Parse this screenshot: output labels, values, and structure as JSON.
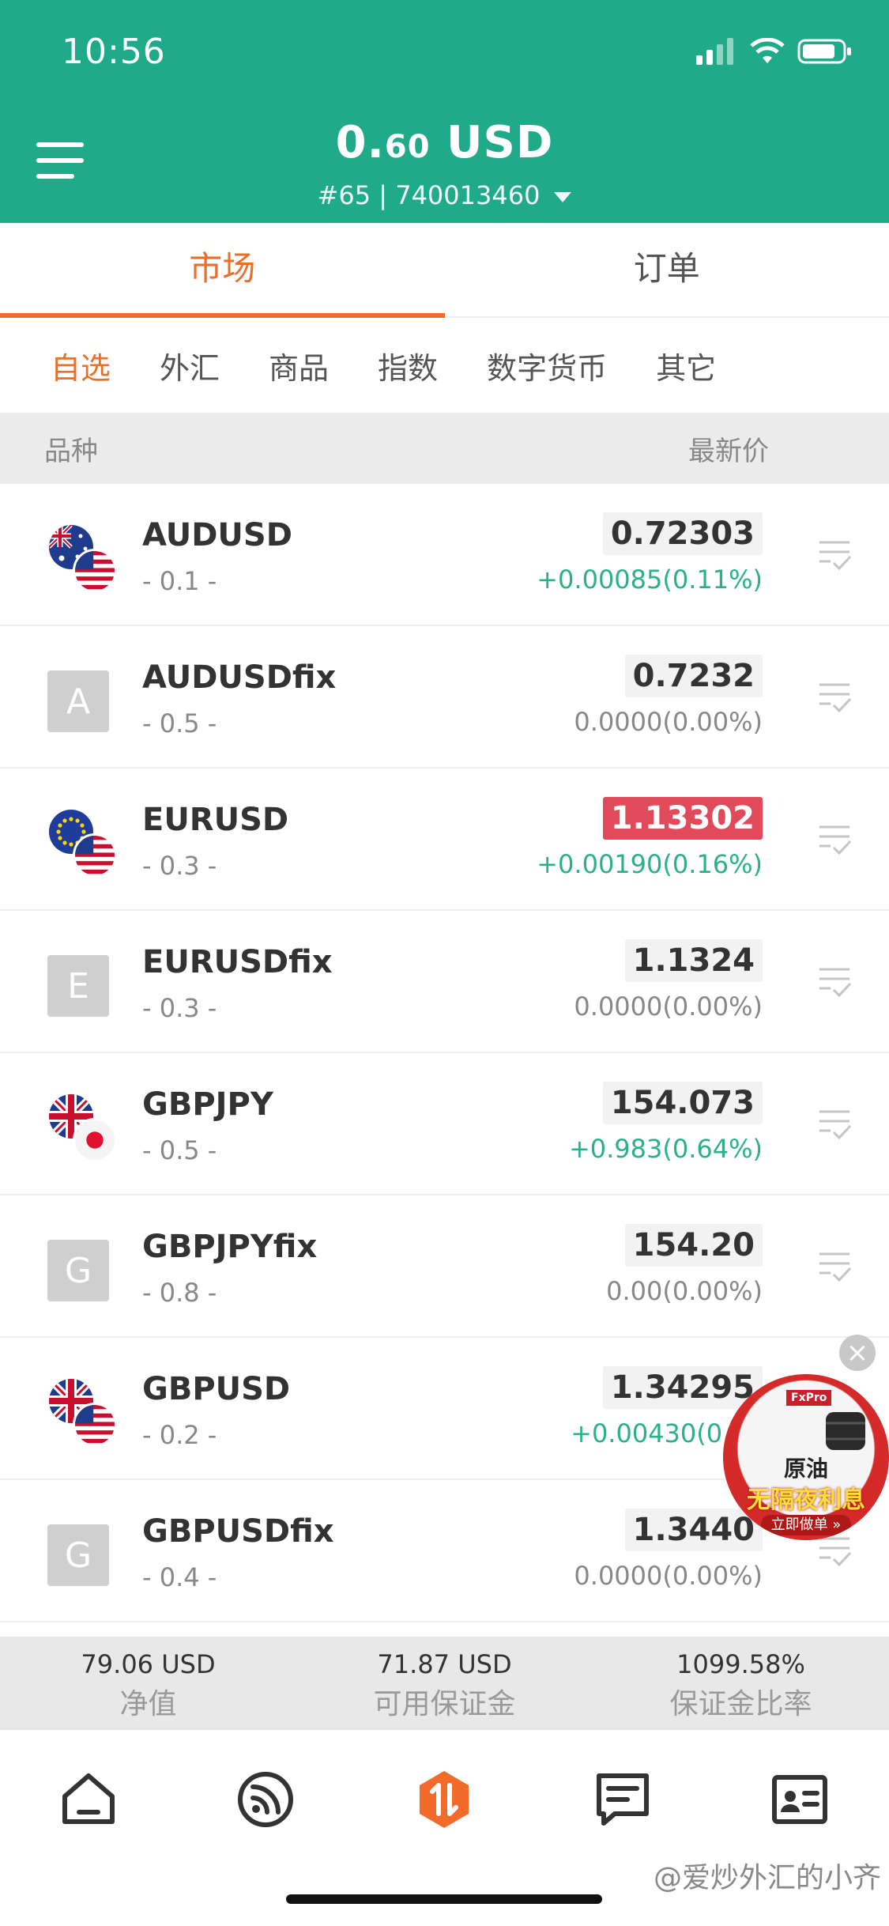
{
  "status": {
    "time": "10:56"
  },
  "header": {
    "balance_int": "0.",
    "balance_dec": "60",
    "balance_currency": " USD",
    "account": "#65 | 740013460"
  },
  "main_tabs": [
    {
      "label": "市场",
      "active": true
    },
    {
      "label": "订单",
      "active": false
    }
  ],
  "sub_tabs": [
    {
      "label": "自选",
      "active": true
    },
    {
      "label": "外汇",
      "active": false
    },
    {
      "label": "商品",
      "active": false
    },
    {
      "label": "指数",
      "active": false
    },
    {
      "label": "数字货币",
      "active": false
    },
    {
      "label": "其它",
      "active": false
    }
  ],
  "columns": {
    "symbol": "品种",
    "price": "最新价"
  },
  "rows": [
    {
      "symbol": "AUDUSD",
      "spread": "- 0.1 -",
      "price": "0.72303",
      "change": "+0.00085(0.11%)",
      "change_up": true,
      "price_down": false,
      "icon": "flag-au-us"
    },
    {
      "symbol": "AUDUSDfix",
      "spread": "- 0.5 -",
      "price": "0.7232",
      "change": "0.0000(0.00%)",
      "change_up": false,
      "price_down": false,
      "icon": "letter-icon",
      "letter": "A"
    },
    {
      "symbol": "EURUSD",
      "spread": "- 0.3 -",
      "price": "1.13302",
      "change": "+0.00190(0.16%)",
      "change_up": true,
      "price_down": true,
      "icon": "flag-eu-us"
    },
    {
      "symbol": "EURUSDfix",
      "spread": "- 0.3 -",
      "price": "1.1324",
      "change": "0.0000(0.00%)",
      "change_up": false,
      "price_down": false,
      "icon": "letter-icon",
      "letter": "E"
    },
    {
      "symbol": "GBPJPY",
      "spread": "- 0.5 -",
      "price": "154.073",
      "change": "+0.983(0.64%)",
      "change_up": true,
      "price_down": false,
      "icon": "flag-gb-jp"
    },
    {
      "symbol": "GBPJPYfix",
      "spread": "- 0.8 -",
      "price": "154.20",
      "change": "0.00(0.00%)",
      "change_up": false,
      "price_down": false,
      "icon": "letter-icon",
      "letter": "G"
    },
    {
      "symbol": "GBPUSD",
      "spread": "- 0.2 -",
      "price": "1.34295",
      "change": "+0.00430(0.32",
      "change_up": true,
      "price_down": false,
      "icon": "flag-gb-us"
    },
    {
      "symbol": "GBPUSDfix",
      "spread": "- 0.4 -",
      "price": "1.3440",
      "change": "0.0000(0.00%)",
      "change_up": false,
      "price_down": false,
      "icon": "letter-icon",
      "letter": "G"
    }
  ],
  "summary": [
    {
      "value": "79.06 USD",
      "label": "净值"
    },
    {
      "value": "71.87 USD",
      "label": "可用保证金"
    },
    {
      "value": "1099.58%",
      "label": "保证金比率"
    }
  ],
  "ad": {
    "brand": "FxPro",
    "line1": "原油",
    "line2": "无隔夜利息",
    "line3": "立即做单 »",
    "close": "×"
  },
  "nav_icons": [
    "home-icon",
    "feed-icon",
    "trade-icon",
    "news-icon",
    "profile-icon"
  ],
  "watermark": "@爱炒外汇的小齐",
  "colors": {
    "header": "#1fab89",
    "accent": "#e8702a",
    "up": "#2bb08a",
    "down": "#e04a5a"
  }
}
